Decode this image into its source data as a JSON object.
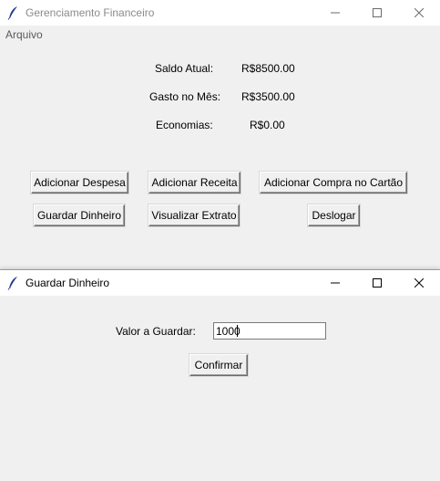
{
  "main_window": {
    "title": "Gerenciamento Financeiro",
    "menu": {
      "arquivo": "Arquivo"
    },
    "summary": {
      "saldo_label": "Saldo Atual:",
      "saldo_value": "R$8500.00",
      "gasto_label": "Gasto no Mês:",
      "gasto_value": "R$3500.00",
      "economias_label": "Economias:",
      "economias_value": "R$0.00"
    },
    "buttons": {
      "adicionar_despesa": "Adicionar Despesa",
      "adicionar_receita": "Adicionar Receita",
      "adicionar_compra_cartao": "Adicionar Compra no Cartão",
      "guardar_dinheiro": "Guardar Dinheiro",
      "visualizar_extrato": "Visualizar Extrato",
      "deslogar": "Deslogar"
    }
  },
  "dialog": {
    "title": "Guardar Dinheiro",
    "field_label": "Valor a Guardar:",
    "field_value": "1000",
    "confirm_label": "Confirmar"
  },
  "icons": {
    "app": "feather-icon",
    "minimize": "minimize-icon",
    "maximize": "maximize-icon",
    "close": "close-icon"
  }
}
